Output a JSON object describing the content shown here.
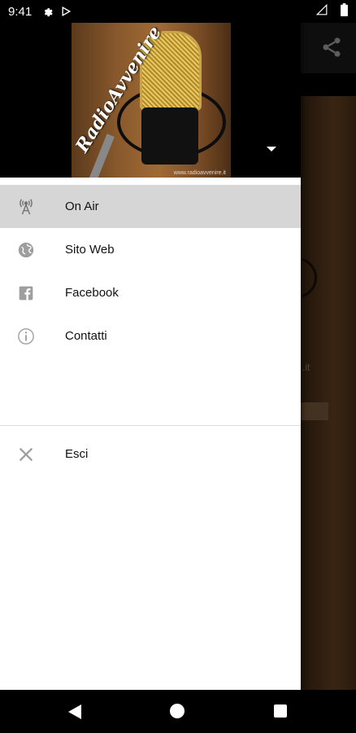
{
  "status_bar": {
    "time": "9:41",
    "icons": [
      "settings-gear-icon",
      "play-store-icon"
    ],
    "right_icons": [
      "signal-icon",
      "battery-icon"
    ]
  },
  "header": {
    "logo_text": "RadioAvvenire",
    "logo_url": "www.radioavvenire.it"
  },
  "menu": {
    "items": [
      {
        "label": "On Air",
        "icon": "radio-tower-icon",
        "active": true
      },
      {
        "label": "Sito Web",
        "icon": "globe-icon",
        "active": false
      },
      {
        "label": "Facebook",
        "icon": "facebook-icon",
        "active": false
      },
      {
        "label": "Contatti",
        "icon": "info-icon",
        "active": false
      }
    ],
    "secondary": [
      {
        "label": "Esci",
        "icon": "close-x-icon"
      }
    ]
  },
  "background": {
    "url_fragment": ".it"
  },
  "colors": {
    "active_item_bg": "#d6d6d6",
    "icon_gray": "#9e9e9e",
    "drawer_bg": "#ffffff"
  }
}
